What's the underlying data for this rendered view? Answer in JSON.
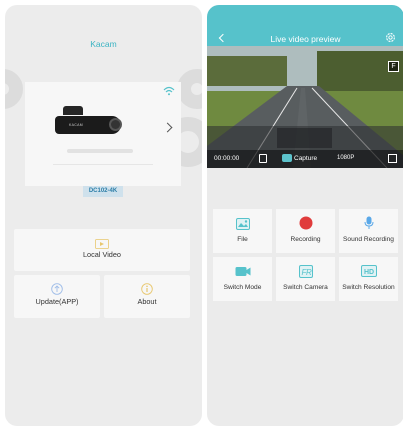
{
  "left_screen": {
    "app_title": "Kacam",
    "device": {
      "brand_text": "KACAM",
      "model_badge": "DC102-4K"
    },
    "menu": {
      "local_video": "Local Video",
      "update": "Update(APP)",
      "about": "About"
    }
  },
  "right_screen": {
    "header_title": "Live video preview",
    "video": {
      "timestamp": "00:00:00",
      "capture_label": "Capture",
      "resolution": "1080P",
      "lens_badge": "F"
    },
    "functions": [
      {
        "label": "File",
        "icon": "image-icon"
      },
      {
        "label": "Recording",
        "icon": "record-icon"
      },
      {
        "label": "Sound Recording",
        "icon": "microphone-icon"
      },
      {
        "label": "Switch Mode",
        "icon": "video-camera-icon"
      },
      {
        "label": "Switch Camera",
        "icon": "switch-camera-icon"
      },
      {
        "label": "Switch Resolution",
        "icon": "hd-icon"
      }
    ]
  },
  "colors": {
    "accent": "#56c2cb",
    "record_red": "#e03c3c",
    "badge_blue": "#cfe1ec"
  }
}
